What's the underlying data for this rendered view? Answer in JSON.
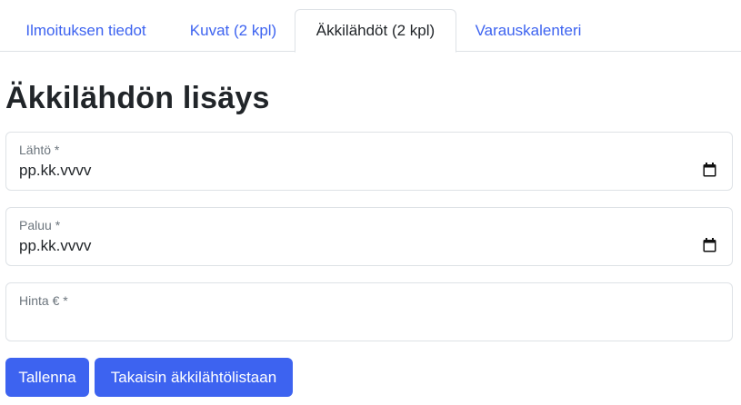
{
  "tabs": [
    {
      "label": "Ilmoituksen tiedot",
      "active": false
    },
    {
      "label": "Kuvat (2 kpl)",
      "active": false
    },
    {
      "label": "Äkkilähdöt (2 kpl)",
      "active": true
    },
    {
      "label": "Varauskalenteri",
      "active": false
    }
  ],
  "page_title": "Äkkilähdön lisäys",
  "form": {
    "departure": {
      "label": "Lähtö *",
      "value": "pp.kk.vvvv",
      "icon": "calendar-icon"
    },
    "return": {
      "label": "Paluu *",
      "value": "pp.kk.vvvv",
      "icon": "calendar-icon"
    },
    "price": {
      "label": "Hinta € *",
      "value": ""
    }
  },
  "buttons": {
    "save": "Tallenna",
    "back": "Takaisin äkkilähtölistaan"
  },
  "colors": {
    "accent": "#3d63f0",
    "text": "#212529",
    "muted": "#6c757d",
    "border": "#dee2e6"
  }
}
